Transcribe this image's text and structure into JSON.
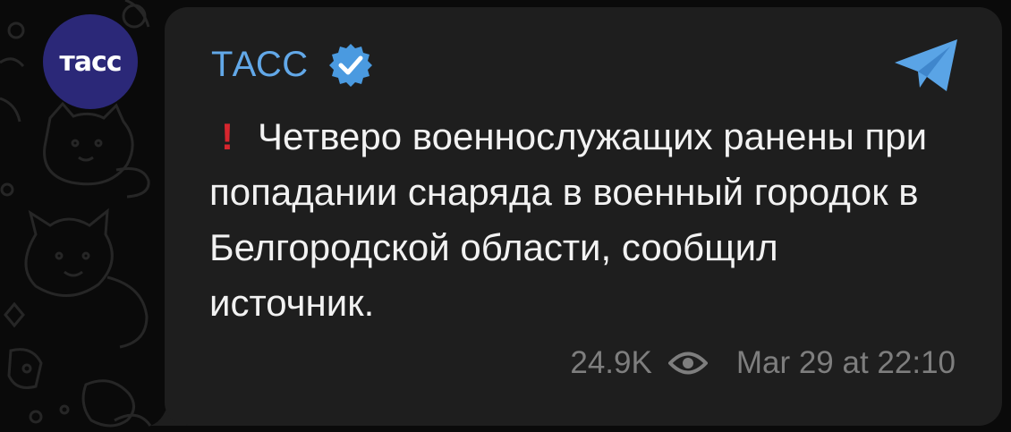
{
  "avatar": {
    "text": "тасс",
    "color": "#2b2878"
  },
  "channel": {
    "name": "ТАСС",
    "verified": true,
    "name_color": "#62a8e8"
  },
  "message": {
    "alert_icon": "exclamation-mark",
    "text": "Четверо военнослужащих ранены при попадании снаряда в военный городок в Белгородской области, сообщил источник."
  },
  "meta": {
    "views": "24.9K",
    "date": "Mar 29 at 22:10"
  },
  "icons": {
    "share": "telegram-share-icon",
    "views": "eye-icon",
    "verified": "verified-badge-icon"
  }
}
